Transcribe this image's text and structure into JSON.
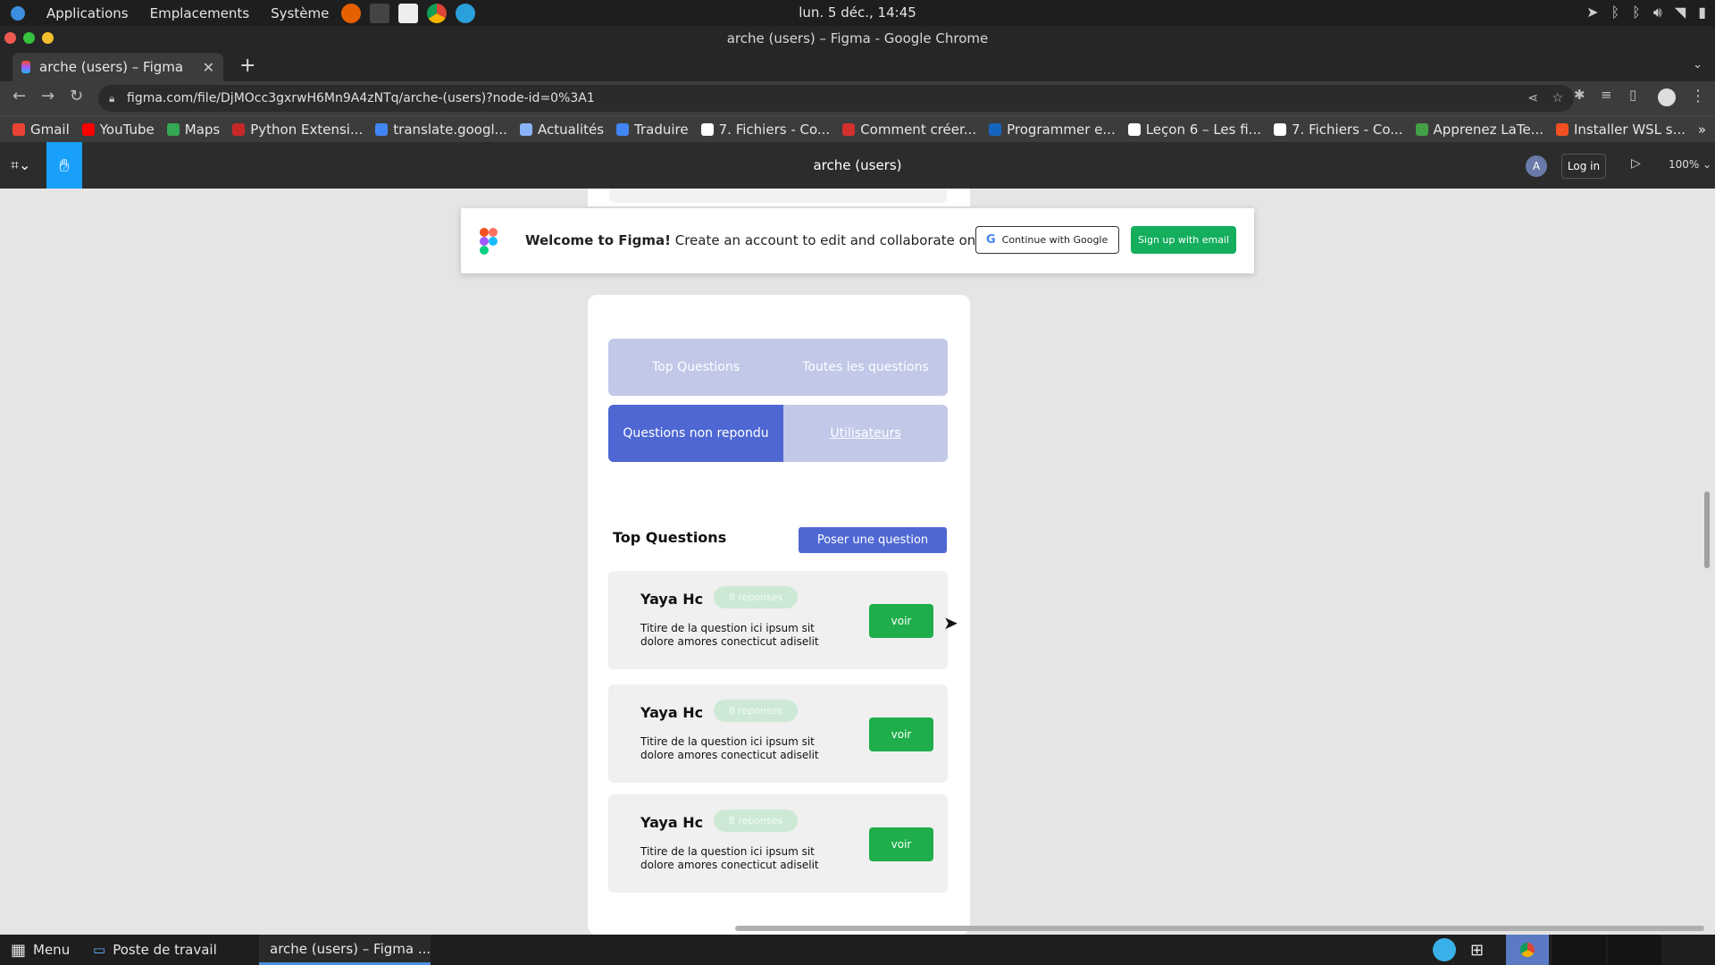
{
  "os_panel": {
    "menus": [
      "Applications",
      "Emplacements",
      "Système"
    ],
    "clock": "lun.  5 déc., 14:45"
  },
  "window": {
    "title": "arche (users) – Figma - Google Chrome"
  },
  "browser": {
    "tab_title": "arche (users) – Figma",
    "url": "figma.com/file/DjMOcc3gxrwH6Mn9A4zNTq/arche-(users)?node-id=0%3A1",
    "bookmarks": [
      {
        "label": "Gmail",
        "color": "#ea4335"
      },
      {
        "label": "YouTube",
        "color": "#ff0000"
      },
      {
        "label": "Maps",
        "color": "#34a853"
      },
      {
        "label": "Python Extensi...",
        "color": "#c62828"
      },
      {
        "label": "translate.googl...",
        "color": "#4285f4"
      },
      {
        "label": "Actualités",
        "color": "#8ab4f8"
      },
      {
        "label": "Traduire",
        "color": "#4285f4"
      },
      {
        "label": "7. Fichiers - Co...",
        "color": "#ffffff"
      },
      {
        "label": "Comment créer...",
        "color": "#d32f2f"
      },
      {
        "label": "Programmer e...",
        "color": "#1565c0"
      },
      {
        "label": "Leçon 6 – Les fi...",
        "color": "#ffffff"
      },
      {
        "label": "7. Fichiers - Co...",
        "color": "#ffffff"
      },
      {
        "label": "Apprenez LaTe...",
        "color": "#43a047"
      },
      {
        "label": "Installer WSL s...",
        "color": "#f25022"
      }
    ]
  },
  "figma": {
    "file_title": "arche (users)",
    "avatar_letter": "A",
    "login_label": "Log in",
    "zoom": "100%",
    "banner": {
      "bold": "Welcome to Figma!",
      "text": " Create an account to edit and collaborate on this file.",
      "google_button": "Continue with Google",
      "email_button": "Sign up with email"
    }
  },
  "design": {
    "tabs_row1": [
      "Top Questions",
      "Toutes les questions"
    ],
    "tabs_row2": [
      "Questions non repondu",
      "Utilisateurs"
    ],
    "section_title": "Top Questions",
    "ask_button": "Poser une question",
    "questions": [
      {
        "author": "Yaya Hc",
        "badge": "8 reponses",
        "text": "Titire de la question ici ipsum sit dolore amores conecticut adiselit",
        "button": "voir"
      },
      {
        "author": "Yaya Hc",
        "badge": "8 reponses",
        "text": "Titire de la question ici ipsum sit dolore amores conecticut adiselit",
        "button": "voir"
      },
      {
        "author": "Yaya Hc",
        "badge": "8 reponses",
        "text": "Titire de la question ici ipsum sit dolore amores conecticut adiselit",
        "button": "voir"
      }
    ],
    "colors": {
      "primary": "#4f67d3",
      "tab_bg": "#c1c8e8",
      "success": "#1fae4b",
      "badge": "#cde9d5"
    }
  },
  "taskbar": {
    "menu_label": "Menu",
    "workspace_label": "Poste de travail",
    "active_window": "arche (users) – Figma ..."
  }
}
